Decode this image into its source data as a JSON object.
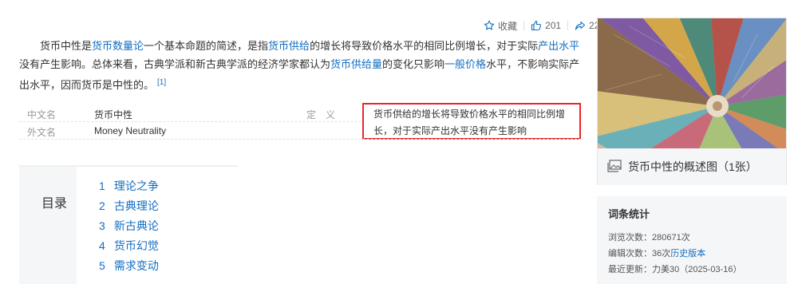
{
  "toolbar": {
    "favorite_label": "收藏",
    "like_count": "201",
    "share_count": "22"
  },
  "intro": {
    "t1": "货币中性是",
    "l1": "货币数量论",
    "t2": "一个基本命题的简述，是指",
    "l2": "货币供给",
    "t3": "的增长将导致价格水平的相同比例增长，对于实际",
    "l3": "产出水平",
    "t4": "没有产生影响。总体来看，古典学派和新古典学派的经济学家都认为",
    "l4": "货币供给量",
    "t5": "的变化只影响",
    "l5": "一般价格",
    "t6": "水平，不影响实际产出水平，因而货币是中性的。",
    "ref": "[1]"
  },
  "basic_info": {
    "rows": [
      {
        "name": "中文名",
        "value": "货币中性"
      },
      {
        "name": "外文名",
        "value": "Money Neutrality"
      }
    ],
    "def_name": "定义",
    "def_value": "货币供给的增长将导致价格水平的相同比例增长，对于实际产出水平没有产生影响"
  },
  "toc": {
    "title": "目录",
    "items": [
      {
        "num": "1",
        "label": "理论之争"
      },
      {
        "num": "2",
        "label": "古典理论"
      },
      {
        "num": "3",
        "label": "新古典论"
      },
      {
        "num": "4",
        "label": "货币幻觉"
      },
      {
        "num": "5",
        "label": "需求变动"
      }
    ]
  },
  "album": {
    "caption": "货币中性的概述图（1张）"
  },
  "stats": {
    "title": "词条统计",
    "views_label": "浏览次数：",
    "views_value": "280671次",
    "edits_label": "编辑次数：",
    "edits_value": "36次",
    "history_link": "历史版本",
    "updated_label": "最近更新：",
    "updated_user": "力美30",
    "updated_date": "（2025-03-16）"
  },
  "colors": {
    "link": "#136ec2",
    "highlight_border": "#e8262b",
    "panel_bg": "#f5f6f8"
  }
}
